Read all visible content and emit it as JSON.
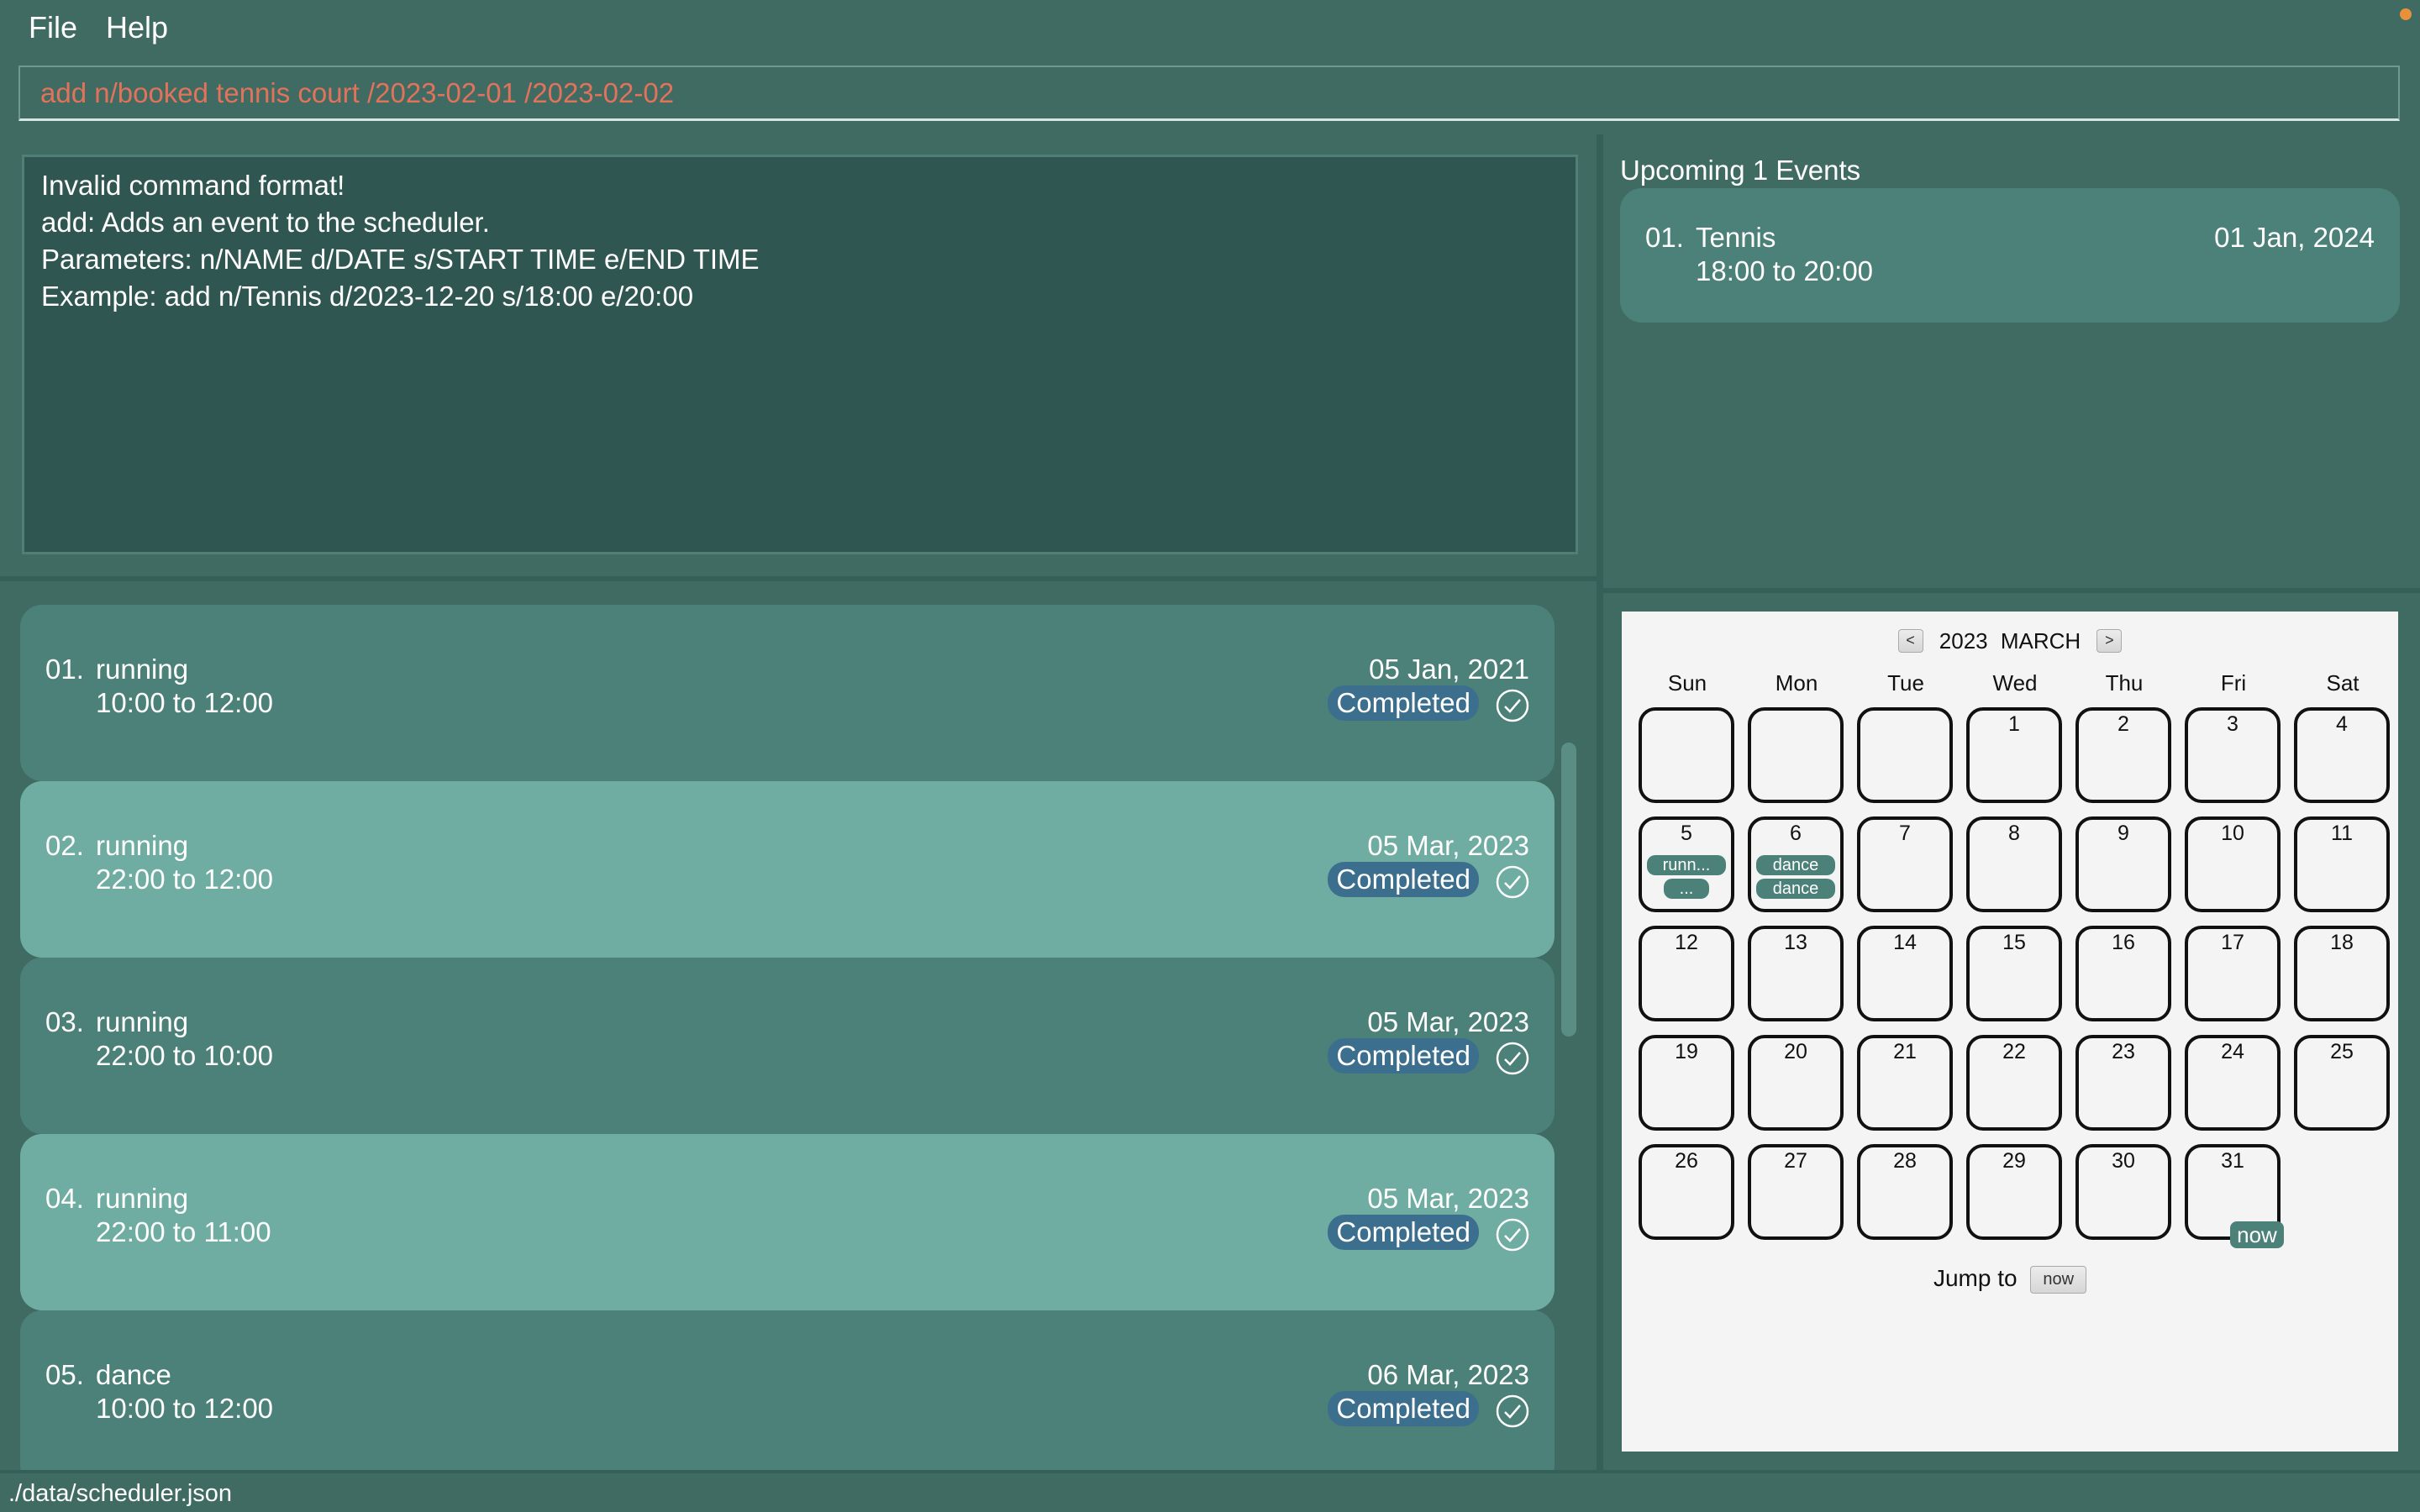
{
  "menu": {
    "file": "File",
    "help": "Help"
  },
  "command": {
    "value": "add n/booked tennis court /2023-02-01 /2023-02-02"
  },
  "result": {
    "lines": [
      "Invalid command format!",
      "add: Adds an event to the scheduler.",
      "Parameters: n/NAME d/DATE s/START TIME e/END TIME",
      "Example: add n/Tennis d/2023-12-20 s/18:00 e/20:00"
    ]
  },
  "events": [
    {
      "index": "01.",
      "name": "running",
      "time": "10:00 to 12:00",
      "date": "05 Jan, 2021",
      "status": "Completed"
    },
    {
      "index": "02.",
      "name": "running",
      "time": "22:00 to 12:00",
      "date": "05 Mar, 2023",
      "status": "Completed"
    },
    {
      "index": "03.",
      "name": "running",
      "time": "22:00 to 10:00",
      "date": "05 Mar, 2023",
      "status": "Completed"
    },
    {
      "index": "04.",
      "name": "running",
      "time": "22:00 to 11:00",
      "date": "05 Mar, 2023",
      "status": "Completed"
    },
    {
      "index": "05.",
      "name": "dance",
      "time": "10:00 to 12:00",
      "date": "06 Mar, 2023",
      "status": "Completed"
    }
  ],
  "upcoming": {
    "title": "Upcoming 1 Events",
    "items": [
      {
        "index": "01.",
        "name": "Tennis",
        "time": "18:00 to 20:00",
        "date": "01 Jan, 2024"
      }
    ]
  },
  "calendar": {
    "prev": "<",
    "next": ">",
    "year": "2023",
    "month": "MARCH",
    "weekdays": [
      "Sun",
      "Mon",
      "Tue",
      "Wed",
      "Thu",
      "Fri",
      "Sat"
    ],
    "days": [
      "1",
      "2",
      "3",
      "4",
      "5",
      "6",
      "7",
      "8",
      "9",
      "10",
      "11",
      "12",
      "13",
      "14",
      "15",
      "16",
      "17",
      "18",
      "19",
      "20",
      "21",
      "22",
      "23",
      "24",
      "25",
      "26",
      "27",
      "28",
      "29",
      "30",
      "31"
    ],
    "day5_tags": [
      "runn...",
      "..."
    ],
    "day6_tags": [
      "dance",
      "dance"
    ],
    "now_tag": "now",
    "jump_label": "Jump to",
    "jump_button": "now"
  },
  "status": {
    "path": "./data/scheduler.json"
  }
}
